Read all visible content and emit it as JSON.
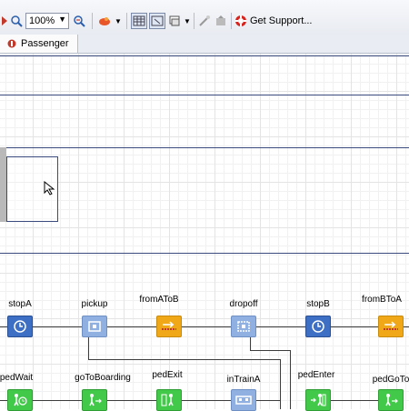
{
  "toolbar": {
    "zoom_value": "100%",
    "get_support_label": "Get Support..."
  },
  "tabs": [
    {
      "label": "Passenger"
    }
  ],
  "blocks": {
    "row1": [
      {
        "name": "stopA",
        "label": "stopA"
      },
      {
        "name": "pickup",
        "label": "pickup"
      },
      {
        "name": "fromAToB",
        "label": "fromAToB"
      },
      {
        "name": "dropoff",
        "label": "dropoff"
      },
      {
        "name": "stopB",
        "label": "stopB"
      },
      {
        "name": "fromBToA",
        "label": "fromBToA"
      }
    ],
    "row2": [
      {
        "name": "pedWait",
        "label": "pedWait"
      },
      {
        "name": "goToBoarding",
        "label": "goToBoarding"
      },
      {
        "name": "pedExit",
        "label": "pedExit"
      },
      {
        "name": "inTrainA",
        "label": "inTrainA"
      },
      {
        "name": "pedEnter",
        "label": "pedEnter"
      },
      {
        "name": "pedGoTo",
        "label": "pedGoTo"
      }
    ]
  },
  "colors": {
    "block_blue": "#3d6fc4",
    "block_lightblue": "#7fa3d9",
    "block_orange": "#f0a818",
    "block_green": "#43c94a",
    "line_navy": "#3a4a7e"
  }
}
